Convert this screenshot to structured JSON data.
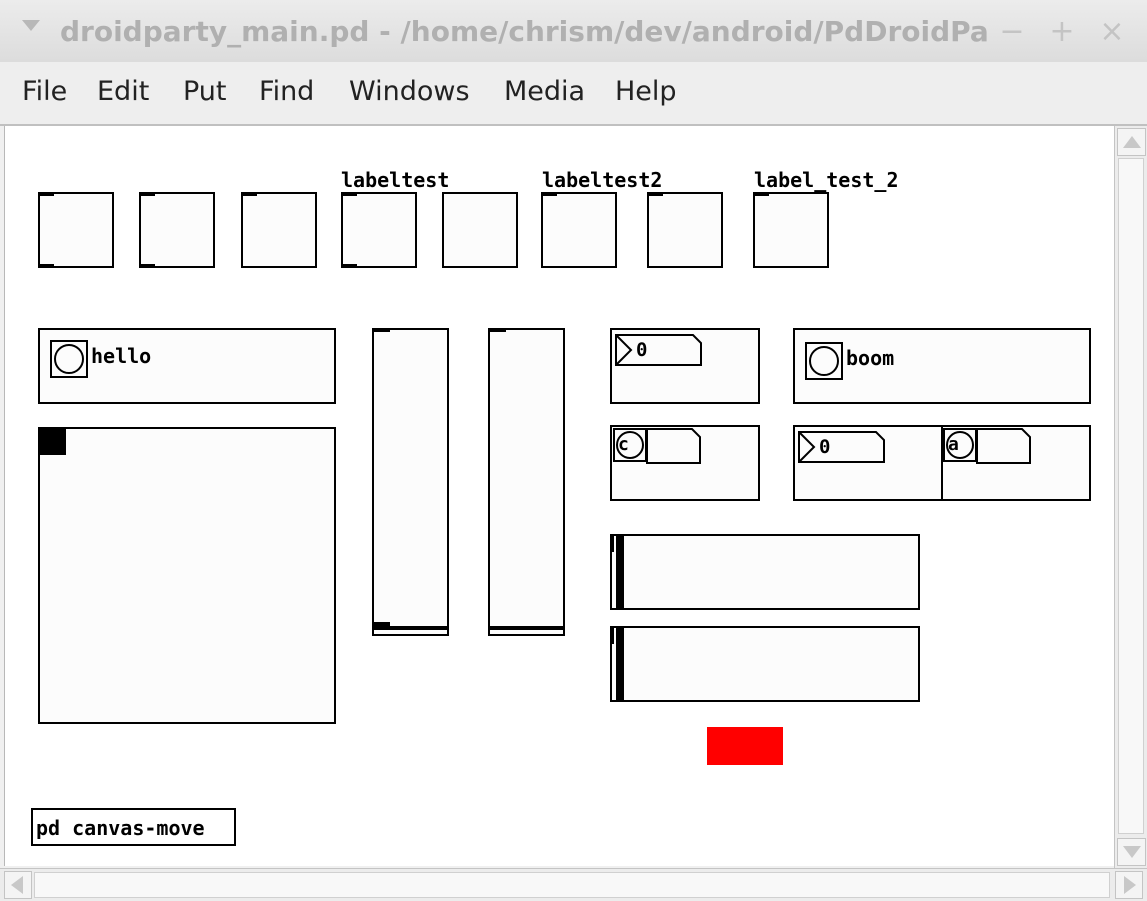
{
  "window": {
    "title": "droidparty_main.pd  - /home/chrism/dev/android/PdDroidParty/droid",
    "minimize_glyph": "−",
    "maximize_glyph": "+",
    "close_glyph": "×"
  },
  "menubar": {
    "items": [
      "File",
      "Edit",
      "Put",
      "Find",
      "Windows",
      "Media",
      "Help"
    ]
  },
  "canvas": {
    "toggle_labels": {
      "t4": "labeltest",
      "t6": "labeltest2",
      "t8": "label_test_2"
    },
    "bang_hello_label": "hello",
    "bang_boom_label": "boom",
    "numbox_a_value": "0",
    "numbox_b_value": "0",
    "small_bang_c_label": "c",
    "small_bang_a_label": "a",
    "subpatch_label": "pd canvas-move",
    "accent_color": "#ff0000"
  }
}
